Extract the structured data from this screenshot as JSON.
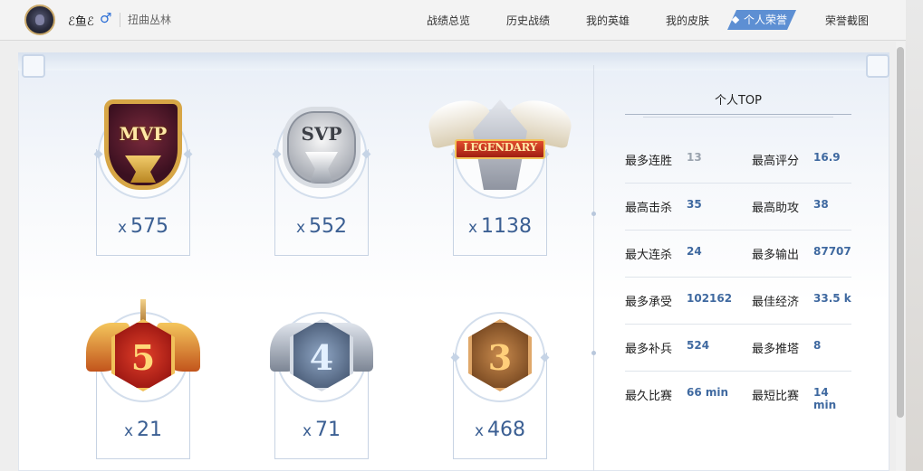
{
  "header": {
    "username": "ℰ鱼ℰ",
    "gender_symbol": "♂",
    "region": "扭曲丛林",
    "nav": [
      {
        "label": "战绩总览"
      },
      {
        "label": "历史战绩"
      },
      {
        "label": "我的英雄"
      },
      {
        "label": "我的皮肤"
      },
      {
        "label": "个人荣誉",
        "active": true
      },
      {
        "label": "荣誉截图"
      }
    ]
  },
  "honors": [
    {
      "emblem": "MVP",
      "icon": "mvp-trophy-icon",
      "prefix": "x",
      "count": "575"
    },
    {
      "emblem": "SVP",
      "icon": "svp-trophy-icon",
      "prefix": "x",
      "count": "552"
    },
    {
      "emblem": "LEGENDARY",
      "icon": "legendary-badge-icon",
      "prefix": "x",
      "count": "1138"
    },
    {
      "emblem": "5",
      "icon": "penta-kill-badge-icon",
      "prefix": "x",
      "count": "21"
    },
    {
      "emblem": "4",
      "icon": "quadra-kill-badge-icon",
      "prefix": "x",
      "count": "71"
    },
    {
      "emblem": "3",
      "icon": "triple-kill-badge-icon",
      "prefix": "x",
      "count": "468"
    }
  ],
  "personal_top": {
    "title": "个人TOP",
    "rows": [
      {
        "l_label": "最多连胜",
        "l_value": "13",
        "r_label": "最高评分",
        "r_value": "16.9"
      },
      {
        "l_label": "最高击杀",
        "l_value": "35",
        "r_label": "最高助攻",
        "r_value": "38"
      },
      {
        "l_label": "最大连杀",
        "l_value": "24",
        "r_label": "最多输出",
        "r_value": "87707"
      },
      {
        "l_label": "最多承受",
        "l_value": "102162",
        "r_label": "最佳经济",
        "r_value": "33.5 k"
      },
      {
        "l_label": "最多补兵",
        "l_value": "524",
        "r_label": "最多推塔",
        "r_value": "8"
      },
      {
        "l_label": "最久比赛",
        "l_value": "66 min",
        "r_label": "最短比赛",
        "r_value": "14 min"
      }
    ]
  },
  "colors": {
    "accent": "#5d8fd3",
    "value_text": "#3f69a0",
    "count_text": "#3b5f93",
    "muted_value": "#9aa3ae"
  }
}
